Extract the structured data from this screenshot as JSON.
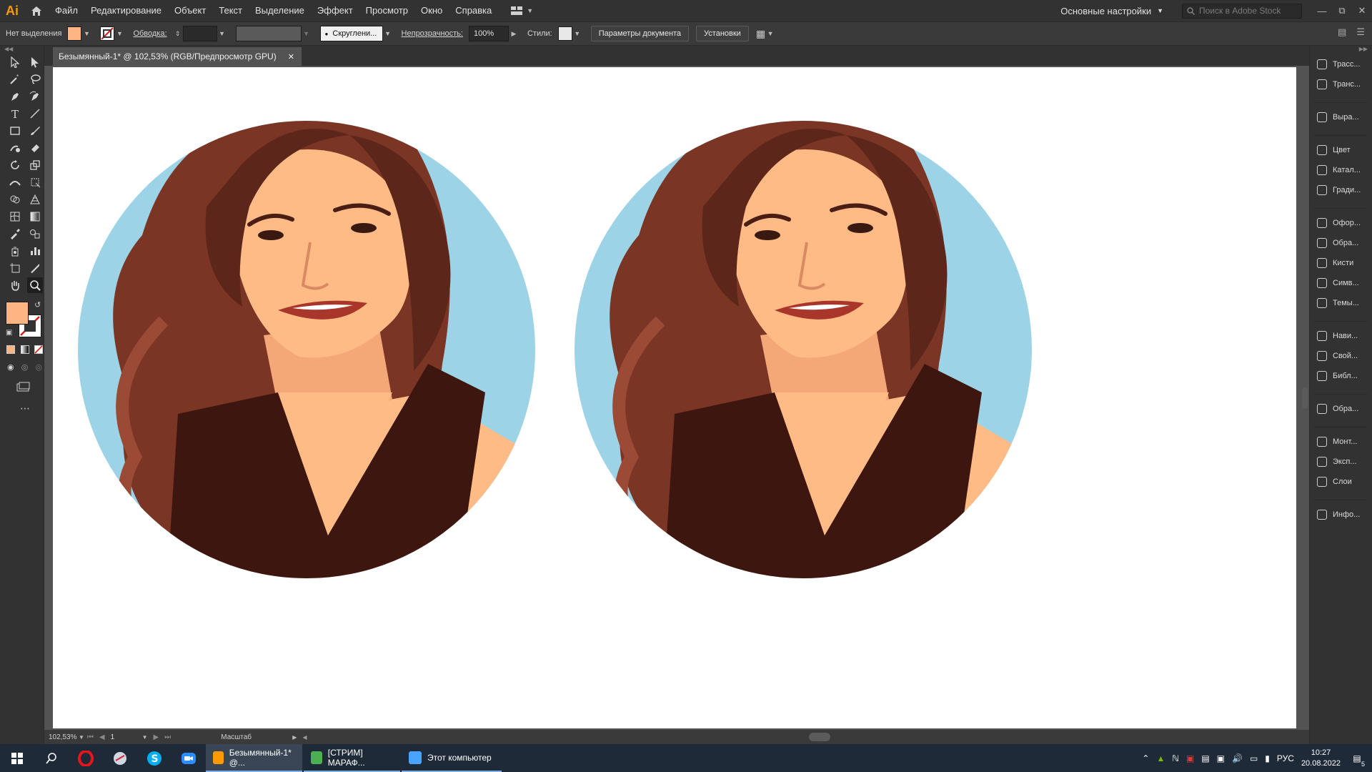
{
  "app": {
    "logo": "Ai",
    "menu": [
      "Файл",
      "Редактирование",
      "Объект",
      "Текст",
      "Выделение",
      "Эффект",
      "Просмотр",
      "Окно",
      "Справка"
    ],
    "workspace": "Основные настройки",
    "stock_search_placeholder": "Поиск в Adobe Stock"
  },
  "control": {
    "selection_label": "Нет выделения",
    "stroke_label": "Обводка:",
    "brush_label": "Скруглени...",
    "opacity_label": "Непрозрачность:",
    "opacity_value": "100%",
    "styles_label": "Стили:",
    "doc_setup": "Параметры документа",
    "prefs": "Установки"
  },
  "document": {
    "tab_title": "Безымянный-1* @ 102,53% (RGB/Предпросмотр GPU)"
  },
  "status": {
    "zoom": "102,53%",
    "artboard_num": "1",
    "tool_name": "Масштаб"
  },
  "right_panels": [
    {
      "label": "Трасс...",
      "icon": "trace-icon"
    },
    {
      "label": "Транс...",
      "icon": "transform-icon"
    },
    {
      "label": "Выра...",
      "icon": "align-icon"
    },
    {
      "label": "Цвет",
      "icon": "color-icon"
    },
    {
      "label": "Катал...",
      "icon": "color-guide-icon"
    },
    {
      "label": "Гради...",
      "icon": "gradient-icon"
    },
    {
      "label": "Офор...",
      "icon": "appearance-icon"
    },
    {
      "label": "Обра...",
      "icon": "graphic-styles-icon"
    },
    {
      "label": "Кисти",
      "icon": "brushes-icon"
    },
    {
      "label": "Симв...",
      "icon": "symbols-icon"
    },
    {
      "label": "Темы...",
      "icon": "themes-icon"
    },
    {
      "label": "Нави...",
      "icon": "navigator-icon"
    },
    {
      "label": "Свой...",
      "icon": "properties-icon"
    },
    {
      "label": "Библ...",
      "icon": "libraries-icon"
    },
    {
      "label": "Обра...",
      "icon": "image-trace-icon"
    },
    {
      "label": "Монт...",
      "icon": "artboards-icon"
    },
    {
      "label": "Эксп...",
      "icon": "export-icon"
    },
    {
      "label": "Слои",
      "icon": "layers-icon"
    },
    {
      "label": "Инфо...",
      "icon": "info-icon"
    }
  ],
  "taskbar": {
    "apps": [
      {
        "label": "Безымянный-1* @...",
        "icon": "illustrator-icon",
        "active": true
      },
      {
        "label": "[СТРИМ] МАРАФ...",
        "icon": "chrome-icon",
        "active": false
      },
      {
        "label": "Этот компьютер",
        "icon": "explorer-icon",
        "active": false
      }
    ],
    "lang": "РУС",
    "time": "10:27",
    "date": "20.08.2022",
    "notifications": "5"
  },
  "colors": {
    "fill": "#ffb583",
    "circle_bg": "#9dd3e6",
    "skin": "#ffbb85",
    "hair": "#7a3525",
    "top": "#3e1610"
  }
}
